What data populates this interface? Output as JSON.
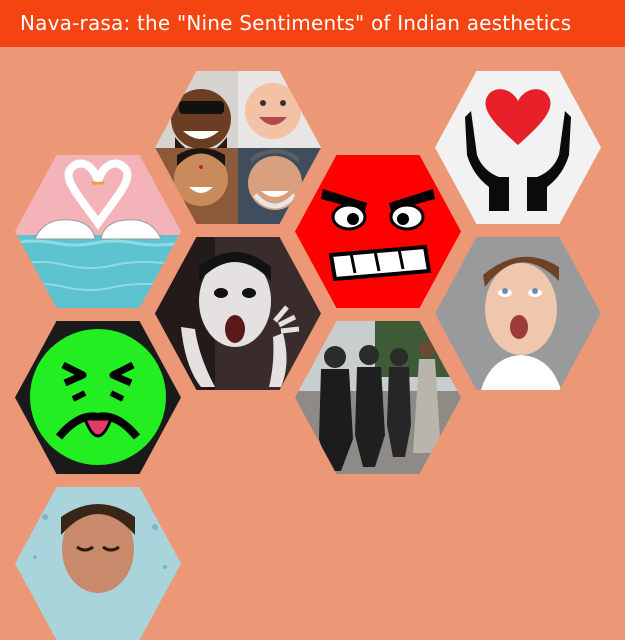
{
  "title": "Nava-rasa: the \"Nine Sentiments\" of Indian aesthetics",
  "tiles": [
    {
      "id": "laughing-faces",
      "icon": "laughing-faces-collage"
    },
    {
      "id": "love",
      "icon": "swans-heart-image"
    },
    {
      "id": "anger",
      "icon": "angry-face-emoji"
    },
    {
      "id": "compassion",
      "icon": "hands-holding-heart-icon"
    },
    {
      "id": "fear",
      "icon": "frightened-face-image"
    },
    {
      "id": "wonder",
      "icon": "astonished-boy-image"
    },
    {
      "id": "disgust",
      "icon": "disgusted-face-emoji"
    },
    {
      "id": "courage",
      "icon": "protester-facing-police-image"
    },
    {
      "id": "peace",
      "icon": "meditating-face-image"
    }
  ],
  "colors": {
    "background": "#ec9877",
    "title_bar": "#f44411",
    "title_text": "#ffffff",
    "anger_red": "#fe0000",
    "disgust_green": "#22ee22"
  }
}
